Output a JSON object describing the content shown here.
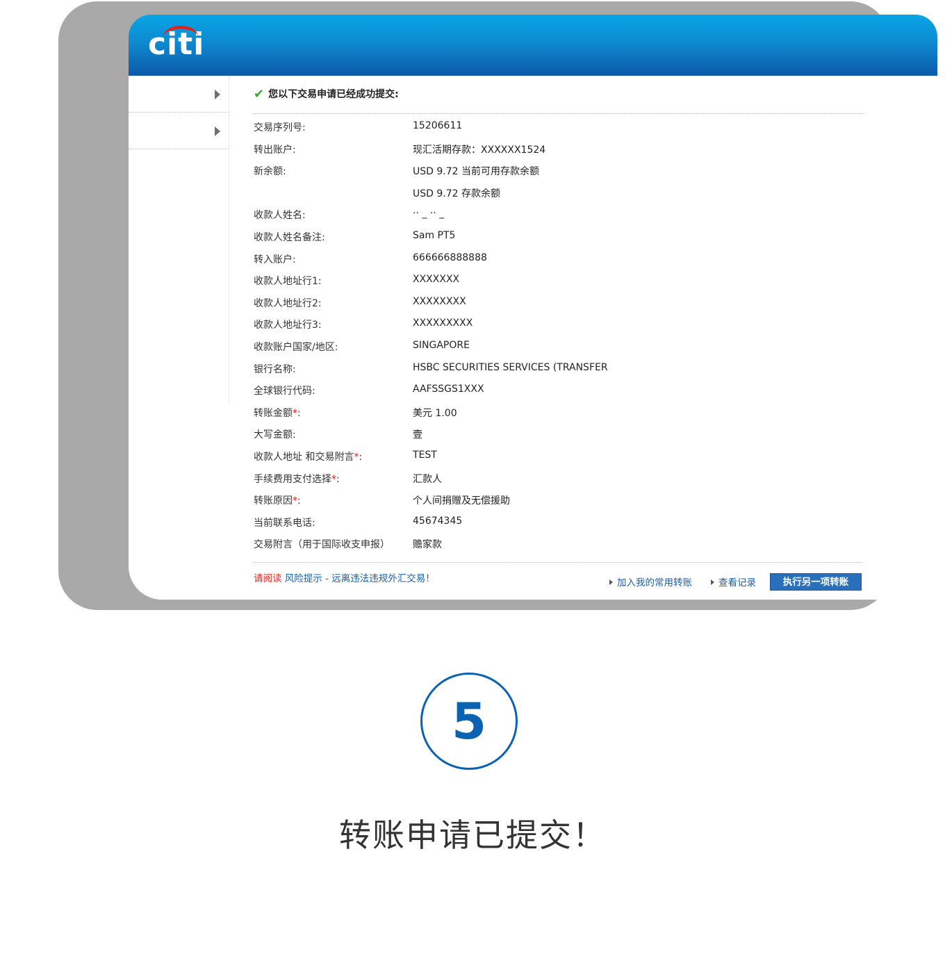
{
  "header": {
    "logo": "citi"
  },
  "success_message": "您以下交易申请已经成功提交:",
  "details": [
    {
      "label": "交易序列号:",
      "value": "15206611"
    },
    {
      "label": "转出账户:",
      "value": "现汇活期存款：XXXXXX1524"
    },
    {
      "label": "新余额:",
      "value": "USD 9.72 当前可用存款余额"
    },
    {
      "label": "",
      "value": "USD 9.72 存款余额"
    },
    {
      "label": "收款人姓名:",
      "value": "··  _   ··   _"
    },
    {
      "label": "收款人姓名备注:",
      "value": "Sam PT5"
    },
    {
      "label": "转入账户:",
      "value": "666666888888"
    },
    {
      "label": "收款人地址行1:",
      "value": "XXXXXXX"
    },
    {
      "label": "收款人地址行2:",
      "value": "XXXXXXXX"
    },
    {
      "label": "收款人地址行3:",
      "value": "XXXXXXXXX"
    },
    {
      "label": "收款账户国家/地区:",
      "value": "SINGAPORE"
    },
    {
      "label": "银行名称:",
      "value": "HSBC SECURITIES SERVICES (TRANSFER"
    },
    {
      "label": "全球银行代码:",
      "value": "AAFSSGS1XXX"
    },
    {
      "label": "转账金额",
      "required": "*",
      "suffix": ":",
      "value": "美元 1.00"
    },
    {
      "label": "大写金额:",
      "value": "壹"
    },
    {
      "label": "收款人地址 和交易附言",
      "required": "*",
      "suffix": ":",
      "value": "TEST"
    },
    {
      "label": "手续费用支付选择",
      "required": "*",
      "suffix": ":",
      "value": "汇款人"
    },
    {
      "label": "转账原因",
      "required": "*",
      "suffix": ":",
      "value": "个人间捐赠及无偿援助"
    },
    {
      "label": "当前联系电话:",
      "value": "45674345"
    },
    {
      "label": "交易附言（用于国际收支申报）",
      "value": "赡家款"
    }
  ],
  "footer": {
    "read_prefix": "请阅读",
    "read_link": "风险提示 - 远离违法违规外汇交易！",
    "add_favorite": "加入我的常用转账",
    "view_records": "查看记录",
    "execute_another": "执行另一项转账"
  },
  "step": {
    "number": "5",
    "caption": "转账申请已提交！"
  },
  "colors": {
    "brand_blue": "#0b62b0",
    "header_top": "#08a6e6",
    "header_bottom": "#0b5aa8",
    "required_red": "#e2231a",
    "success_green": "#3fa535"
  }
}
